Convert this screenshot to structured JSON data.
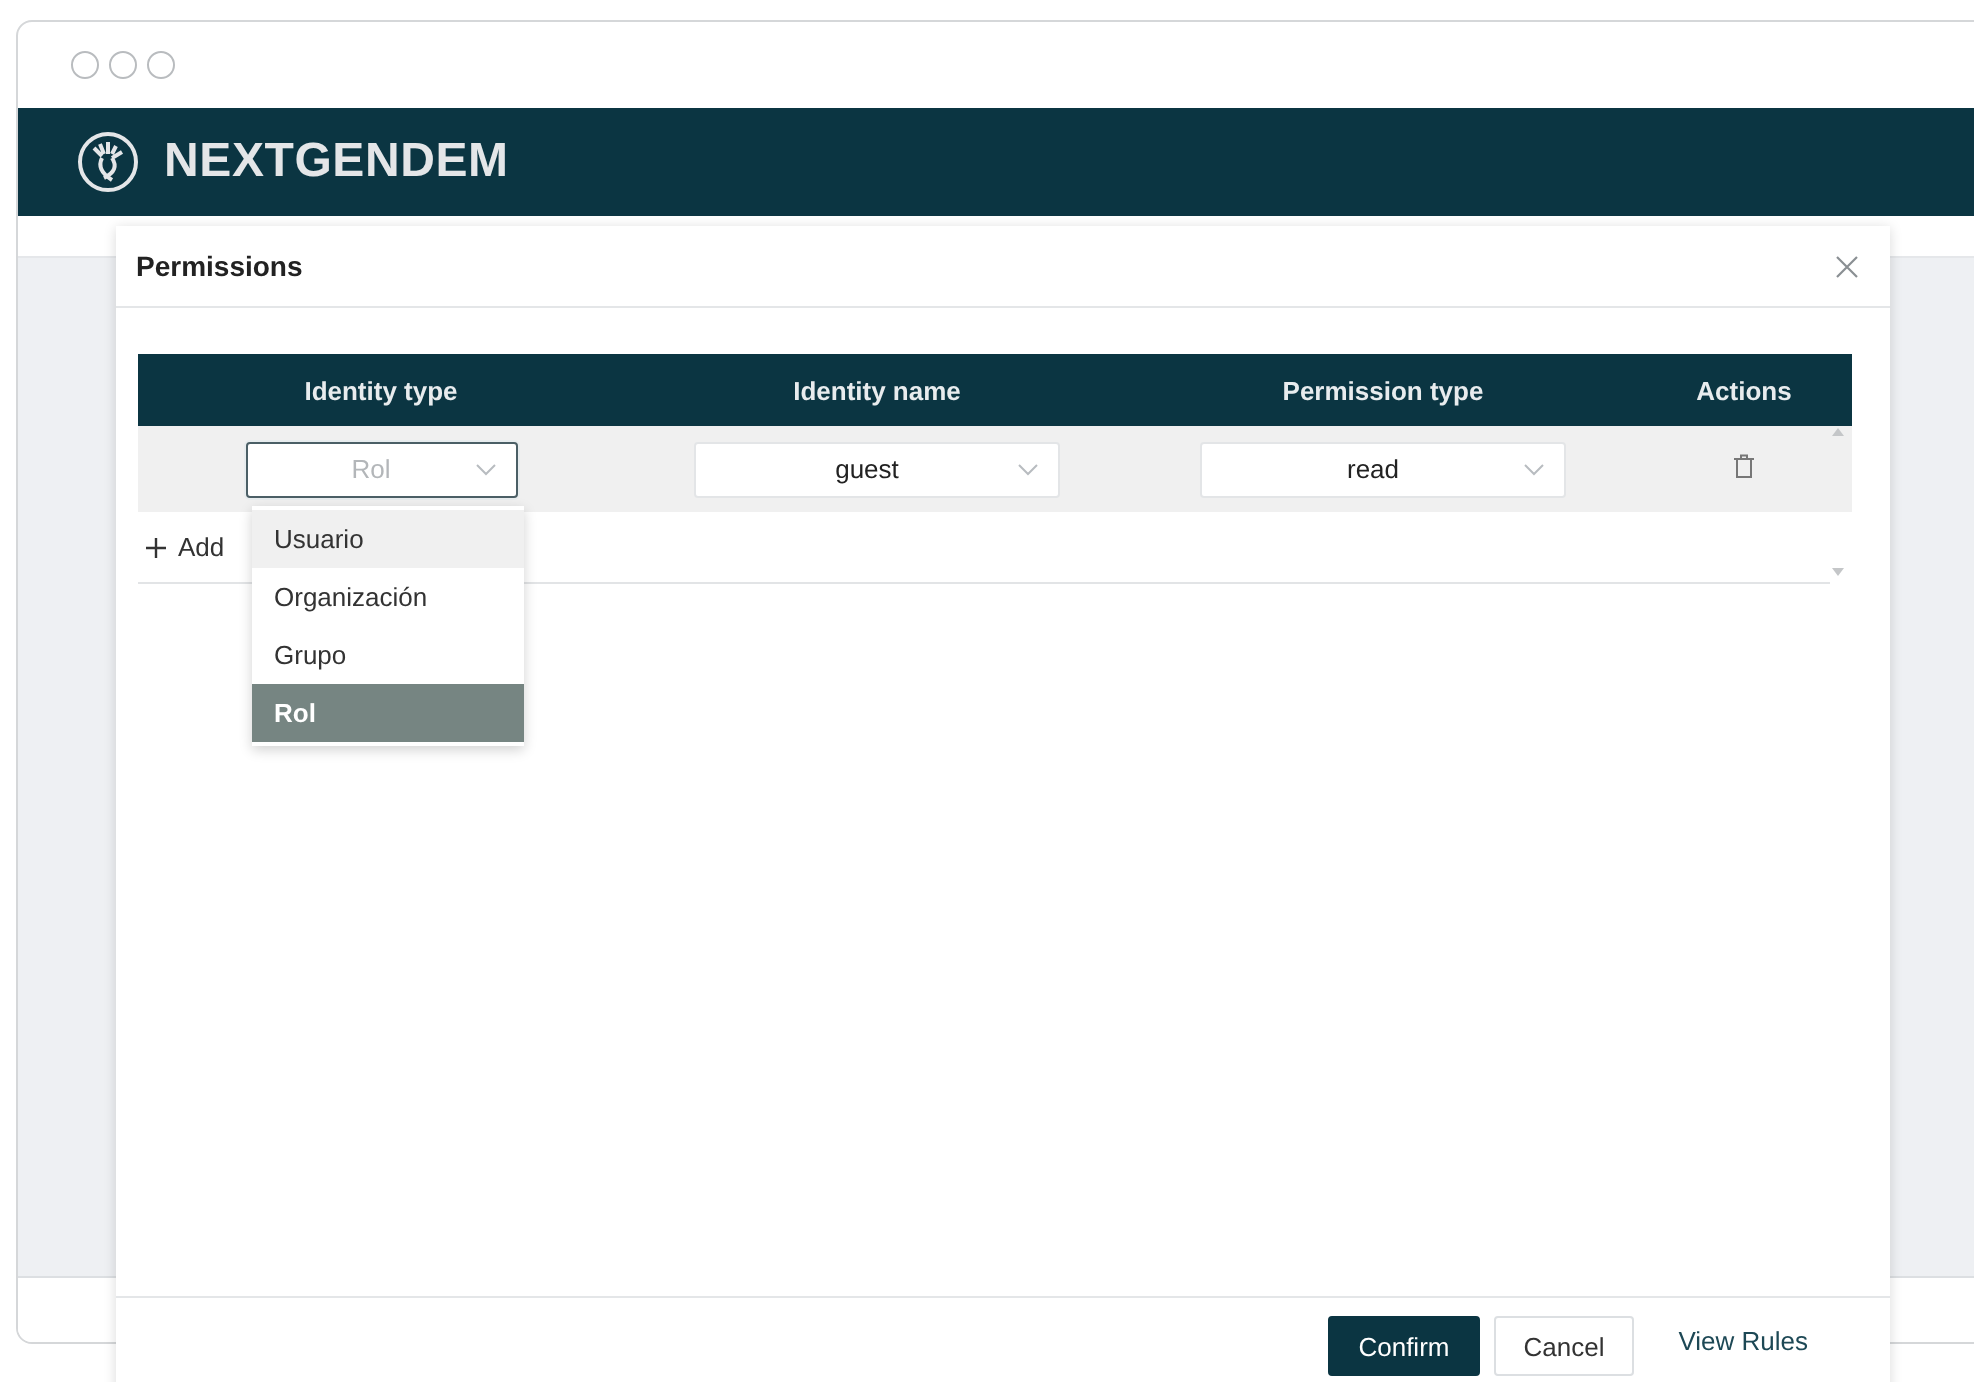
{
  "app": {
    "title": "NEXTGENDEM"
  },
  "dialog": {
    "title": "Permissions",
    "table": {
      "columns": [
        "Identity type",
        "Identity name",
        "Permission type",
        "Actions"
      ],
      "rows": [
        {
          "identity_type": {
            "value": "Rol",
            "open": true
          },
          "identity_name": {
            "value": "guest",
            "open": false
          },
          "permission_type": {
            "value": "read",
            "open": false
          }
        }
      ]
    },
    "add_label": "Add",
    "dropdown_options": [
      {
        "label": "Usuario",
        "hovered": true,
        "selected": false
      },
      {
        "label": "Organización",
        "hovered": false,
        "selected": false
      },
      {
        "label": "Grupo",
        "hovered": false,
        "selected": false
      },
      {
        "label": "Rol",
        "hovered": false,
        "selected": true
      }
    ],
    "buttons": [
      {
        "label": "Confirm",
        "kind": "primary"
      },
      {
        "label": "Cancel",
        "kind": "default"
      },
      {
        "label": "View Rules",
        "kind": "link"
      }
    ]
  }
}
